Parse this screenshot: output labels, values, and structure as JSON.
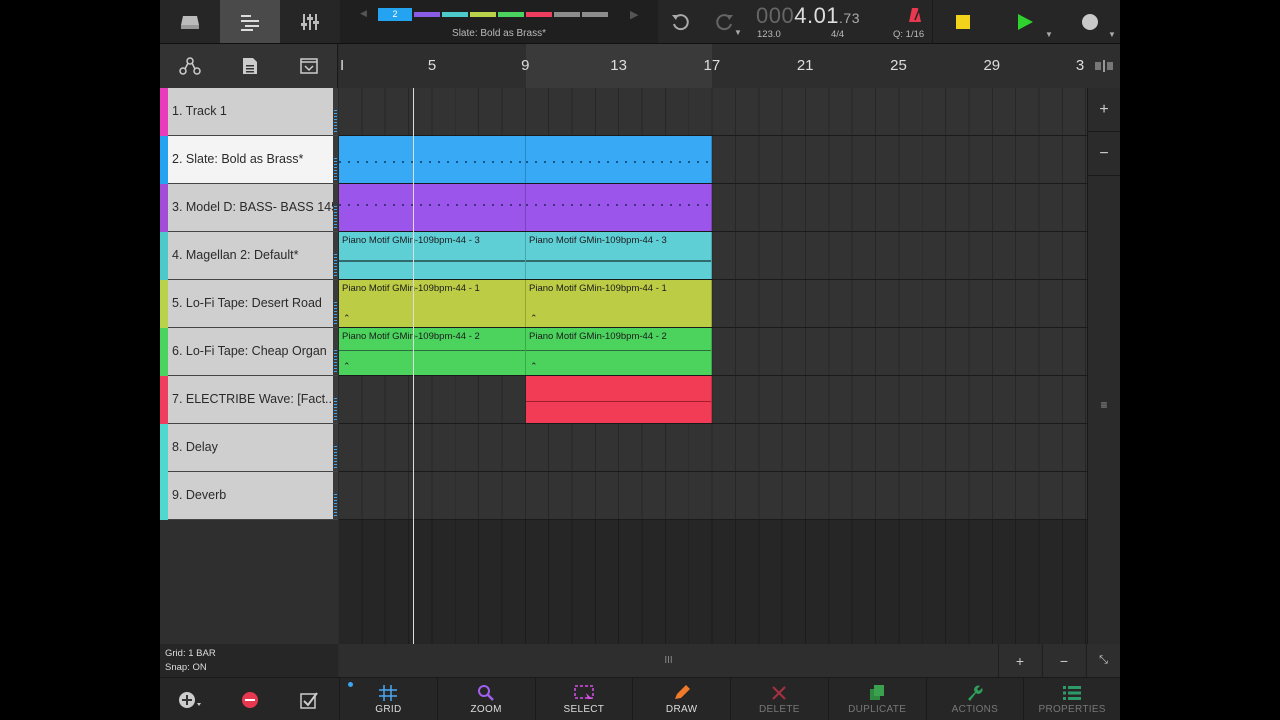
{
  "song_strip": {
    "scene_number": "2",
    "segment_colors": [
      "#23a3f0",
      "#8a5ce6",
      "#4cc9c9",
      "#b9d24a",
      "#4ad35e",
      "#ee3d5d",
      "#8c8c8c",
      "#8c8c8c"
    ],
    "track_name": "Slate: Bold as Brass*"
  },
  "transport": {
    "position_prefix": "000",
    "position_main": "4.01",
    "position_ticks": ".73",
    "tempo": "123.0",
    "time_signature": "4/4",
    "quantize": "Q: 1/16"
  },
  "ruler": {
    "first_label": "I",
    "bars": [
      "5",
      "9",
      "13",
      "17",
      "21",
      "25",
      "29",
      "3"
    ]
  },
  "tracks": [
    {
      "name": "1. Track 1",
      "color": "#e83cbd",
      "selected": false
    },
    {
      "name": "2. Slate: Bold as Brass*",
      "color": "#23a3f0",
      "selected": true
    },
    {
      "name": "3. Model D: BASS- BASS 145",
      "color": "#a14dd8",
      "selected": false
    },
    {
      "name": "4. Magellan 2: Default*",
      "color": "#4cc9c9",
      "selected": false
    },
    {
      "name": "5. Lo-Fi Tape: Desert Road",
      "color": "#b9d24a",
      "selected": false
    },
    {
      "name": "6. Lo-Fi Tape: Cheap Organ",
      "color": "#4ad35e",
      "selected": false
    },
    {
      "name": "7. ELECTRIBE Wave: [Fact...",
      "color": "#ee3d5d",
      "selected": false
    },
    {
      "name": "8. Delay",
      "color": "#4fd8d0",
      "selected": false
    },
    {
      "name": "9. Deverb",
      "color": "#4fd8d0",
      "selected": false
    }
  ],
  "clips": {
    "track4": "Piano Motif GMin-109bpm-44 - 3",
    "track5": "Piano Motif GMin-109bpm-44 - 1",
    "track6": "Piano Motif GMin-109bpm-44 - 2"
  },
  "colors": {
    "slate": "#37a9f5",
    "model_d": "#9b55ea",
    "magellan": "#5fcfd6",
    "lofi_desert": "#bccc45",
    "lofi_organ": "#4bd35d",
    "electribe": "#f23c56"
  },
  "status": {
    "grid": "Grid: 1 BAR",
    "snap": "Snap: ON"
  },
  "tools": {
    "grid": "GRID",
    "zoom": "ZOOM",
    "select": "SELECT",
    "draw": "DRAW",
    "delete": "DELETE",
    "duplicate": "DUPLICATE",
    "actions": "ACTIONS",
    "properties": "PROPERTIES"
  }
}
